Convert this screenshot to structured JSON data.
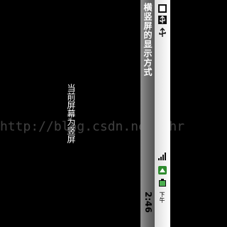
{
  "titlebar": {
    "title": "横竖屏的显示方式"
  },
  "content": {
    "text": "当前屏幕为竖屏"
  },
  "watermark": {
    "text": "http://blog.csdn.net/chr"
  },
  "statusbar": {
    "ampm": "下午",
    "time": "2:46",
    "icons": [
      "notification-icon",
      "usb-icon",
      "usb-debug-icon",
      "signal-icon",
      "network-icon",
      "battery-icon"
    ]
  }
}
